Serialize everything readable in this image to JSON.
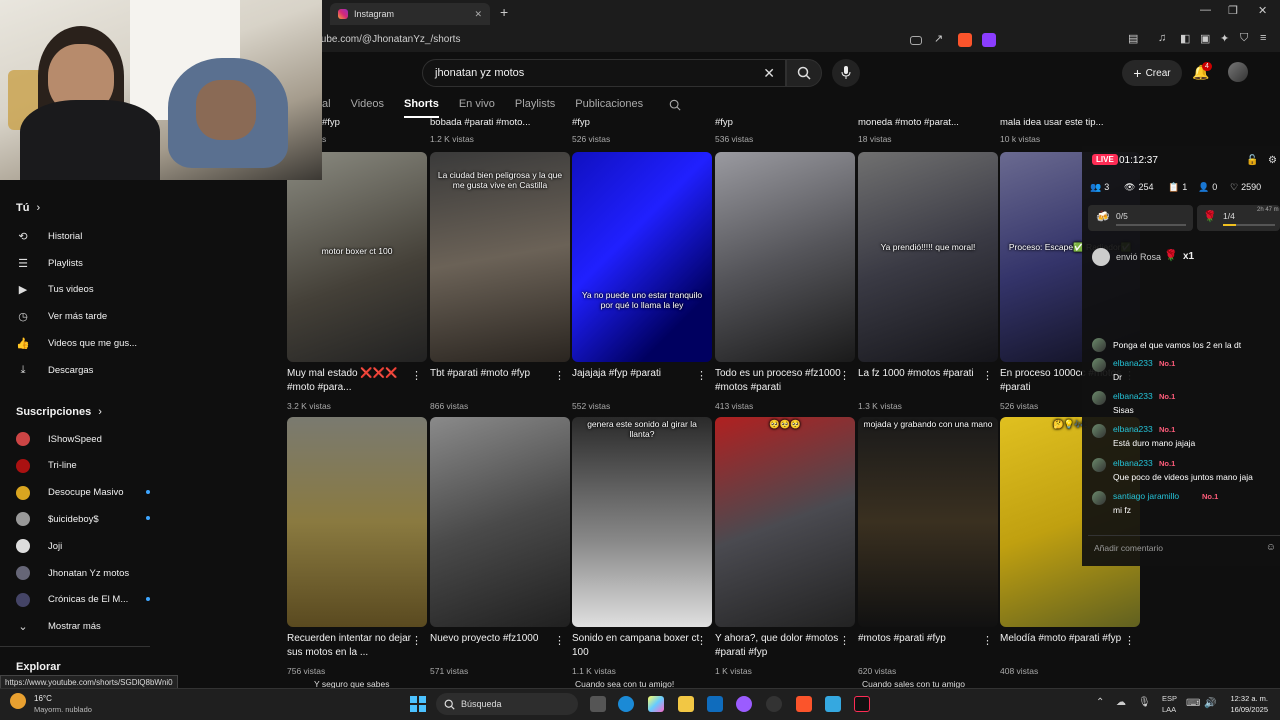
{
  "browser": {
    "tab_title": "Instagram",
    "url": "tube.com/@JhonatanYz_/shorts",
    "status_url": "https://www.youtube.com/shorts/SGDlQ8bWni0"
  },
  "header": {
    "search_value": "jhonatan yz motos",
    "create_label": "Crear",
    "notif_count": "4"
  },
  "channel_tabs": [
    "al",
    "Videos",
    "Shorts",
    "En vivo",
    "Playlists",
    "Publicaciones"
  ],
  "sidebar": {
    "you_label": "Tú",
    "items": [
      {
        "label": "Historial",
        "icon": "history-icon"
      },
      {
        "label": "Playlists",
        "icon": "playlist-icon"
      },
      {
        "label": "Tus videos",
        "icon": "video-icon"
      },
      {
        "label": "Ver más tarde",
        "icon": "clock-icon"
      },
      {
        "label": "Videos que me gus...",
        "icon": "like-icon"
      },
      {
        "label": "Descargas",
        "icon": "download-icon"
      }
    ],
    "subs_label": "Suscripciones",
    "subs": [
      {
        "label": "IShowSpeed",
        "color": "#c44"
      },
      {
        "label": "Tri-line",
        "color": "#a11"
      },
      {
        "label": "Desocupe Masivo",
        "color": "#d9a520"
      },
      {
        "label": "$uicideboy$",
        "color": "#999"
      },
      {
        "label": "Joji",
        "color": "#ddd"
      },
      {
        "label": "Jhonatan Yz motos",
        "color": "#667"
      },
      {
        "label": "Crónicas de El M...",
        "color": "#446"
      }
    ],
    "more_label": "Mostrar más",
    "explore_label": "Explorar"
  },
  "top_row": [
    {
      "title": "#fyp",
      "views": "s"
    },
    {
      "title": "bobada #parati #moto...",
      "views": "1.2 K vistas"
    },
    {
      "title": "#fyp",
      "views": "526 vistas"
    },
    {
      "title": "#fyp",
      "views": "536 vistas"
    },
    {
      "title": "moneda #moto #parat...",
      "views": "18 vistas"
    },
    {
      "title": "mala idea usar este tip...",
      "views": "10 k vistas"
    }
  ],
  "row1": [
    {
      "caption": "motor boxer ct 100",
      "title": "Muy mal estado ❌❌❌ #moto #para...",
      "views": "3.2 K vistas",
      "bg": "linear-gradient(160deg,#8a8a80,#444038 60%,#222)"
    },
    {
      "caption": "La ciudad bien peligrosa y la que me gusta vive en Castilla",
      "title": "Tbt #parati #moto #fyp",
      "views": "866 vistas",
      "bg": "linear-gradient(170deg,#3a3a3a,#6b6257 50%,#2a2520)"
    },
    {
      "caption": "Ya no puede uno estar tranquilo por qué lo llama la ley",
      "title": "Jajajaja #fyp #parati",
      "views": "552 vistas",
      "bg": "linear-gradient(135deg,#1010c0,#2020ff 40%,#000060 80%)"
    },
    {
      "caption": "",
      "title": "Todo es un proceso #fz1000 #motos #parati",
      "views": "413 vistas",
      "bg": "linear-gradient(160deg,#9a9aa0,#55555a 50%,#1a1a1a)"
    },
    {
      "caption": "Ya prendió!!!!! que moral!",
      "title": "La fz 1000 #motos #parati",
      "views": "1.3 K vistas",
      "bg": "linear-gradient(160deg,#707070,#3a3a44 50%,#15151a)"
    },
    {
      "caption": "Proceso: Escape✅ Radiador✅",
      "title": "En proceso 1000cc #motos #parati",
      "views": "526 vistas",
      "bg": "linear-gradient(160deg,#6a6a90,#34346a 50%,#101020)"
    }
  ],
  "row2": [
    {
      "caption": "",
      "title": "Recuerden intentar no dejar sus motos en la ...",
      "views": "756 vistas",
      "bg": "linear-gradient(180deg,#7a7a70,#8a7a40 50%,#5a4a20)"
    },
    {
      "caption": "",
      "title": "Nuevo proyecto #fz1000",
      "views": "571 vistas",
      "bg": "linear-gradient(160deg,#8a8a8a,#4a4a4a 50%,#202020)"
    },
    {
      "caption": "genera este sonido al girar la llanta?",
      "title": "Sonido en campana boxer ct 100",
      "views": "1.1 K vistas",
      "bg": "linear-gradient(180deg,#2a2a2a,#8a8a8a 60%,#e0e0e0)"
    },
    {
      "caption": "🥺🥺🥺",
      "title": "Y ahora?, que dolor #motos #parati #fyp",
      "views": "1 K vistas",
      "bg": "linear-gradient(160deg,#b02020,#4a4a50 50%,#222)"
    },
    {
      "caption": "mojada y grabando con una mano",
      "title": "#motos #parati #fyp",
      "views": "620 vistas",
      "bg": "linear-gradient(180deg,#1a1a1a,#3a3020 50%,#111)"
    },
    {
      "caption": "🤔💡🎶:",
      "title": "Melodía #moto #parati #fyp",
      "views": "408 vistas",
      "bg": "linear-gradient(160deg,#e0c020,#c0a010 50%,#606020)"
    }
  ],
  "bottom_peek": [
    "Y seguro que sabes",
    "Cuando sea con tu amigo!",
    "Cuando sales con tu amigo"
  ],
  "live": {
    "badge": "LIVE",
    "timer": "01:12:37",
    "stats": [
      "3",
      "254",
      "1",
      "0",
      "2590"
    ],
    "goal1": "0/5",
    "goal2": "1/4",
    "goal2_time": "2h 47 m",
    "gift_text": "envió Rosa",
    "gift_count": "x1",
    "chat": [
      {
        "name": "",
        "badge": "",
        "msg": "Ponga el que vamos los 2 en la dt"
      },
      {
        "name": "elbana233",
        "badge": "No.1",
        "msg": "Dr"
      },
      {
        "name": "elbana233",
        "badge": "No.1",
        "msg": "Sisas"
      },
      {
        "name": "elbana233",
        "badge": "No.1",
        "msg": "Está duro mano jajaja"
      },
      {
        "name": "elbana233",
        "badge": "No.1",
        "msg": "Que poco de videos juntos mano jaja"
      },
      {
        "name": "santiago jaramillo",
        "badge": "No.1",
        "msg": "mi fz"
      }
    ],
    "comment_placeholder": "Añadir comentario"
  },
  "taskbar": {
    "weather_temp": "16°C",
    "weather_desc": "Mayorm. nublado",
    "search_label": "Búsqueda",
    "lang": "ESP",
    "lang2": "LAA",
    "time": "12:32 a. m.",
    "date": "16/09/2025"
  }
}
